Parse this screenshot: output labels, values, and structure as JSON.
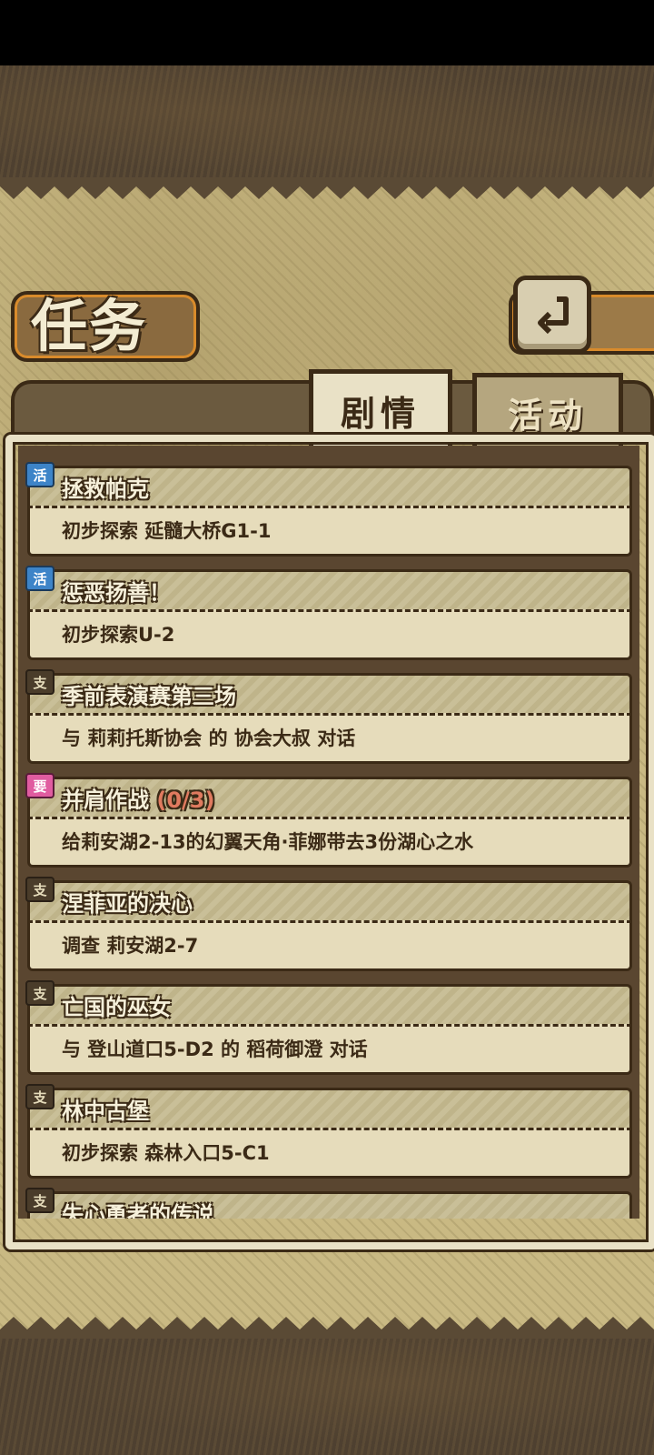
{
  "header": {
    "title": "任务",
    "back_icon": "back-arrow-icon"
  },
  "tabs": [
    {
      "label": "剧情",
      "active": true
    },
    {
      "label": "活动",
      "active": false
    }
  ],
  "quests": [
    {
      "badge": "活",
      "badge_type": "blue",
      "title": "拯救帕克",
      "count": "",
      "desc": "初步探索 延髓大桥G1-1"
    },
    {
      "badge": "活",
      "badge_type": "blue",
      "title": "惩恶扬善！",
      "count": "",
      "desc": "初步探索U-2"
    },
    {
      "badge": "支",
      "badge_type": "main",
      "title": "季前表演赛第三场",
      "count": "",
      "desc": "与 莉莉托斯协会 的 协会大叔 对话"
    },
    {
      "badge": "要",
      "badge_type": "pink",
      "title": "并肩作战",
      "count": "(0/3)",
      "desc": "给莉安湖2-13的幻翼天角·菲娜带去3份湖心之水"
    },
    {
      "badge": "支",
      "badge_type": "main",
      "title": "涅菲亚的决心",
      "count": "",
      "desc": "调查 莉安湖2-7"
    },
    {
      "badge": "支",
      "badge_type": "main",
      "title": "亡国的巫女",
      "count": "",
      "desc": "与 登山道口5-D2 的 稻荷御澄 对话"
    },
    {
      "badge": "支",
      "badge_type": "main",
      "title": "林中古堡",
      "count": "",
      "desc": "初步探索 森林入口5-C1"
    },
    {
      "badge": "支",
      "badge_type": "main",
      "title": "失心勇者的传说",
      "count": "",
      "desc": ""
    }
  ],
  "colors": {
    "parchment": "#c9b983",
    "outline": "#3b2a16",
    "accent_orange": "#d98b2b",
    "count_red": "#e07a5f"
  }
}
